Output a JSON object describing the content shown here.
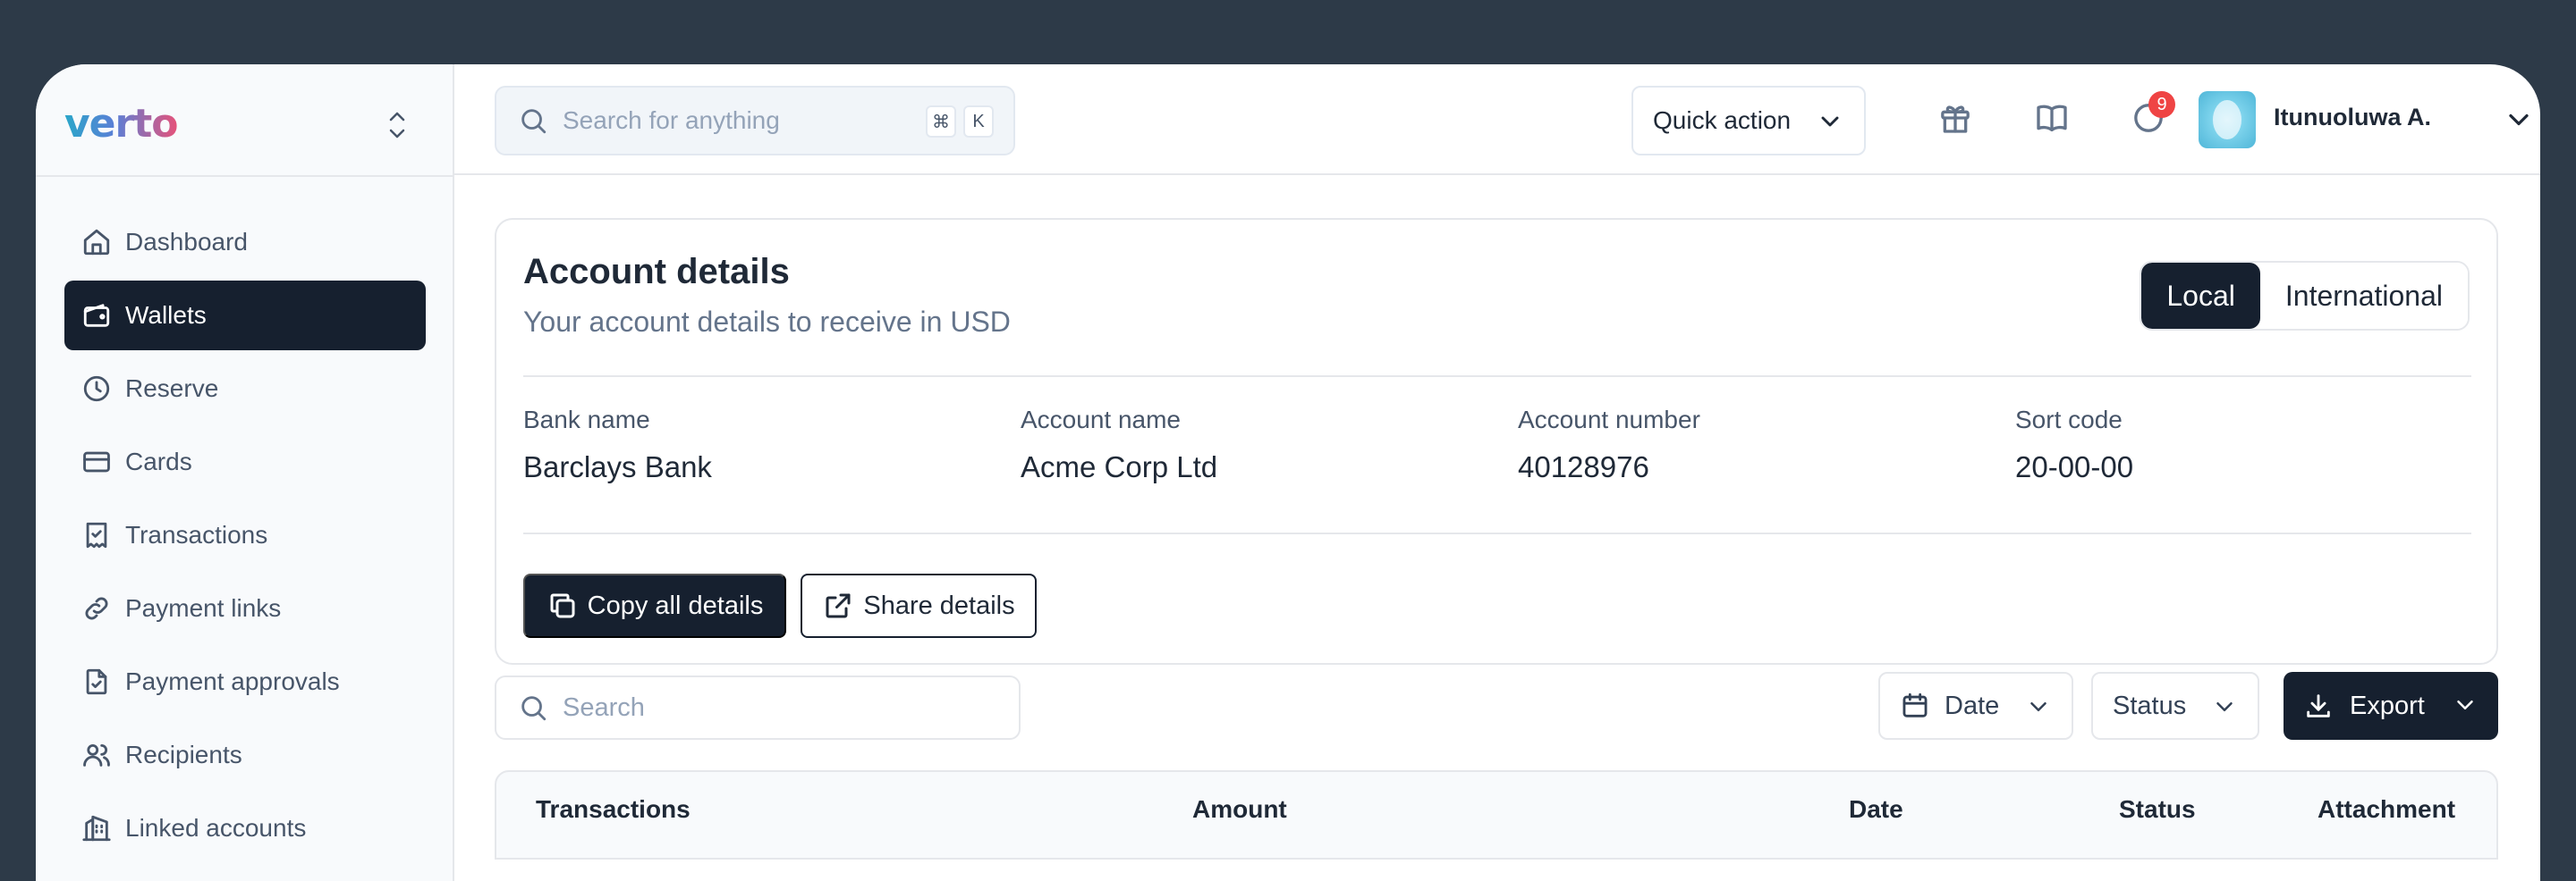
{
  "brand": {
    "logo_text": "verto"
  },
  "sidebar": {
    "items": [
      {
        "label": "Dashboard",
        "icon": "home-icon",
        "active": false
      },
      {
        "label": "Wallets",
        "icon": "wallet-icon",
        "active": true
      },
      {
        "label": "Reserve",
        "icon": "clock-icon",
        "active": false
      },
      {
        "label": "Cards",
        "icon": "credit-card-icon",
        "active": false
      },
      {
        "label": "Transactions",
        "icon": "receipt-icon",
        "active": false
      },
      {
        "label": "Payment links",
        "icon": "link-icon",
        "active": false
      },
      {
        "label": "Payment approvals",
        "icon": "document-check-icon",
        "active": false
      },
      {
        "label": "Recipients",
        "icon": "users-icon",
        "active": false
      },
      {
        "label": "Linked accounts",
        "icon": "bank-icon",
        "active": false
      }
    ]
  },
  "topbar": {
    "search_placeholder": "Search for anything",
    "shortcut_keys": [
      "⌘",
      "K"
    ],
    "quick_action_label": "Quick action",
    "notification_count": "9",
    "user_name": "Itunuoluwa A."
  },
  "account_card": {
    "title": "Account details",
    "subtitle": "Your account details to receive in USD",
    "tabs": [
      {
        "label": "Local",
        "active": true
      },
      {
        "label": "International",
        "active": false
      }
    ],
    "details": [
      {
        "label": "Bank name",
        "value": "Barclays Bank"
      },
      {
        "label": "Account name",
        "value": "Acme Corp Ltd"
      },
      {
        "label": "Account number",
        "value": "40128976"
      },
      {
        "label": "Sort code",
        "value": "20-00-00"
      }
    ],
    "copy_button_label": "Copy all details",
    "share_button_label": "Share details"
  },
  "table_controls": {
    "search_placeholder": "Search",
    "date_filter_label": "Date",
    "status_filter_label": "Status",
    "export_label": "Export"
  },
  "table": {
    "columns": [
      "Transactions",
      "Amount",
      "Date",
      "Status",
      "Attachment"
    ]
  },
  "colors": {
    "frame_background": "#2d3a48",
    "primary_dark": "#16202f",
    "badge_red": "#ef4444"
  }
}
